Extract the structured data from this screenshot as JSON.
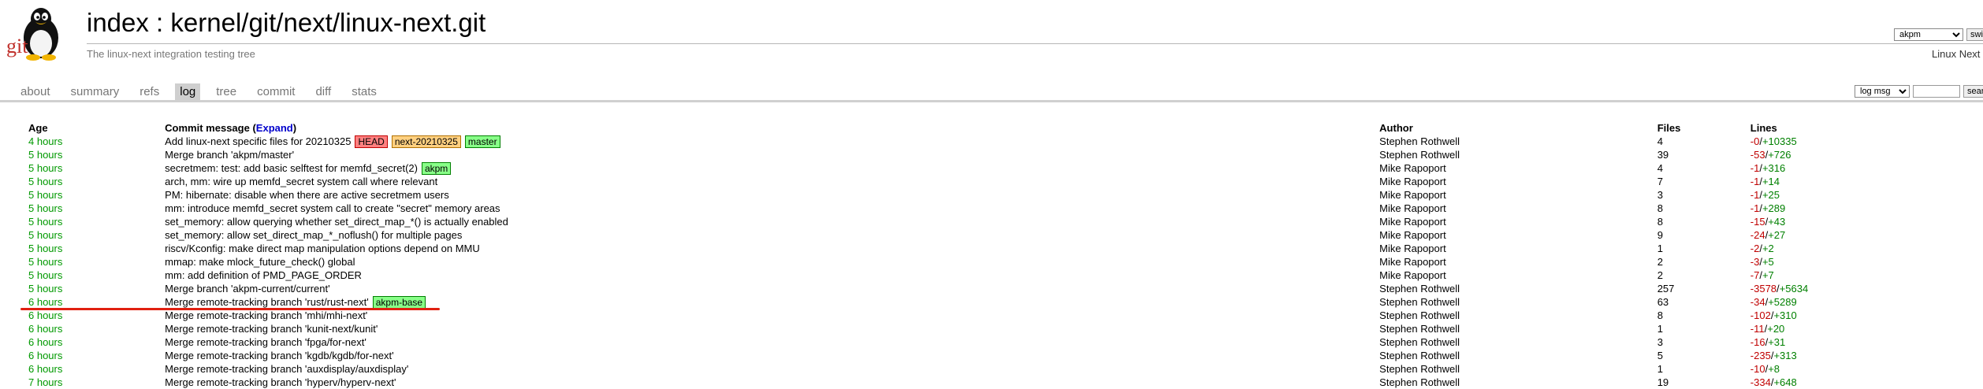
{
  "header": {
    "logo_text": "git",
    "title": "index : kernel/git/next/linux-next.git",
    "description": "The linux-next integration testing tree",
    "branch_select": "akpm",
    "switch_label": "switch",
    "right_label": "Linux Next"
  },
  "tabs": [
    {
      "label": "about"
    },
    {
      "label": "summary"
    },
    {
      "label": "refs"
    },
    {
      "label": "log",
      "active": true
    },
    {
      "label": "tree"
    },
    {
      "label": "commit"
    },
    {
      "label": "diff"
    },
    {
      "label": "stats"
    }
  ],
  "search": {
    "select_value": "log msg",
    "input_value": "",
    "button_label": "search"
  },
  "table": {
    "headers": {
      "age": "Age",
      "commit_message": "Commit message",
      "expand_open": "(",
      "expand": "Expand",
      "expand_close": ")",
      "author": "Author",
      "files": "Files",
      "lines": "Lines"
    },
    "rows": [
      {
        "age": "4 hours",
        "message": "Add linux-next specific files for 20210325",
        "decorations": [
          {
            "label": "HEAD",
            "kind": "head"
          },
          {
            "label": "next-20210325",
            "kind": "tag"
          },
          {
            "label": "master",
            "kind": "branch"
          }
        ],
        "author": "Stephen Rothwell",
        "files": "4",
        "deleted": "-0",
        "added": "+10335"
      },
      {
        "age": "5 hours",
        "message": "Merge branch 'akpm/master'",
        "decorations": [],
        "author": "Stephen Rothwell",
        "files": "39",
        "deleted": "-53",
        "added": "+726"
      },
      {
        "age": "5 hours",
        "message": "secretmem: test: add basic selftest for memfd_secret(2)",
        "decorations": [
          {
            "label": "akpm",
            "kind": "branch"
          }
        ],
        "author": "Mike Rapoport",
        "files": "4",
        "deleted": "-1",
        "added": "+316"
      },
      {
        "age": "5 hours",
        "message": "arch, mm: wire up memfd_secret system call where relevant",
        "decorations": [],
        "author": "Mike Rapoport",
        "files": "7",
        "deleted": "-1",
        "added": "+14"
      },
      {
        "age": "5 hours",
        "message": "PM: hibernate: disable when there are active secretmem users",
        "decorations": [],
        "author": "Mike Rapoport",
        "files": "3",
        "deleted": "-1",
        "added": "+25"
      },
      {
        "age": "5 hours",
        "message": "mm: introduce memfd_secret system call to create \"secret\" memory areas",
        "decorations": [],
        "author": "Mike Rapoport",
        "files": "8",
        "deleted": "-1",
        "added": "+289"
      },
      {
        "age": "5 hours",
        "message": "set_memory: allow querying whether set_direct_map_*() is actually enabled",
        "decorations": [],
        "author": "Mike Rapoport",
        "files": "8",
        "deleted": "-15",
        "added": "+43"
      },
      {
        "age": "5 hours",
        "message": "set_memory: allow set_direct_map_*_noflush() for multiple pages",
        "decorations": [],
        "author": "Mike Rapoport",
        "files": "9",
        "deleted": "-24",
        "added": "+27"
      },
      {
        "age": "5 hours",
        "message": "riscv/Kconfig: make direct map manipulation options depend on MMU",
        "decorations": [],
        "author": "Mike Rapoport",
        "files": "1",
        "deleted": "-2",
        "added": "+2"
      },
      {
        "age": "5 hours",
        "message": "mmap: make mlock_future_check() global",
        "decorations": [],
        "author": "Mike Rapoport",
        "files": "2",
        "deleted": "-3",
        "added": "+5"
      },
      {
        "age": "5 hours",
        "message": "mm: add definition of PMD_PAGE_ORDER",
        "decorations": [],
        "author": "Mike Rapoport",
        "files": "2",
        "deleted": "-7",
        "added": "+7"
      },
      {
        "age": "5 hours",
        "message": "Merge branch 'akpm-current/current'",
        "decorations": [],
        "author": "Stephen Rothwell",
        "files": "257",
        "deleted": "-3578",
        "added": "+5634"
      },
      {
        "age": "6 hours",
        "message": "Merge remote-tracking branch 'rust/rust-next'",
        "decorations": [
          {
            "label": "akpm-base",
            "kind": "branch"
          }
        ],
        "author": "Stephen Rothwell",
        "files": "63",
        "deleted": "-34",
        "added": "+5289"
      },
      {
        "age": "6 hours",
        "message": "Merge remote-tracking branch 'mhi/mhi-next'",
        "decorations": [],
        "author": "Stephen Rothwell",
        "files": "8",
        "deleted": "-102",
        "added": "+310"
      },
      {
        "age": "6 hours",
        "message": "Merge remote-tracking branch 'kunit-next/kunit'",
        "decorations": [],
        "author": "Stephen Rothwell",
        "files": "1",
        "deleted": "-11",
        "added": "+20"
      },
      {
        "age": "6 hours",
        "message": "Merge remote-tracking branch 'fpga/for-next'",
        "decorations": [],
        "author": "Stephen Rothwell",
        "files": "3",
        "deleted": "-16",
        "added": "+31"
      },
      {
        "age": "6 hours",
        "message": "Merge remote-tracking branch 'kgdb/kgdb/for-next'",
        "decorations": [],
        "author": "Stephen Rothwell",
        "files": "5",
        "deleted": "-235",
        "added": "+313"
      },
      {
        "age": "6 hours",
        "message": "Merge remote-tracking branch 'auxdisplay/auxdisplay'",
        "decorations": [],
        "author": "Stephen Rothwell",
        "files": "1",
        "deleted": "-10",
        "added": "+8"
      },
      {
        "age": "7 hours",
        "message": "Merge remote-tracking branch 'hyperv/hyperv-next'",
        "decorations": [],
        "author": "Stephen Rothwell",
        "files": "19",
        "deleted": "-334",
        "added": "+648"
      }
    ]
  },
  "annotation": {
    "color": "#e02010"
  }
}
